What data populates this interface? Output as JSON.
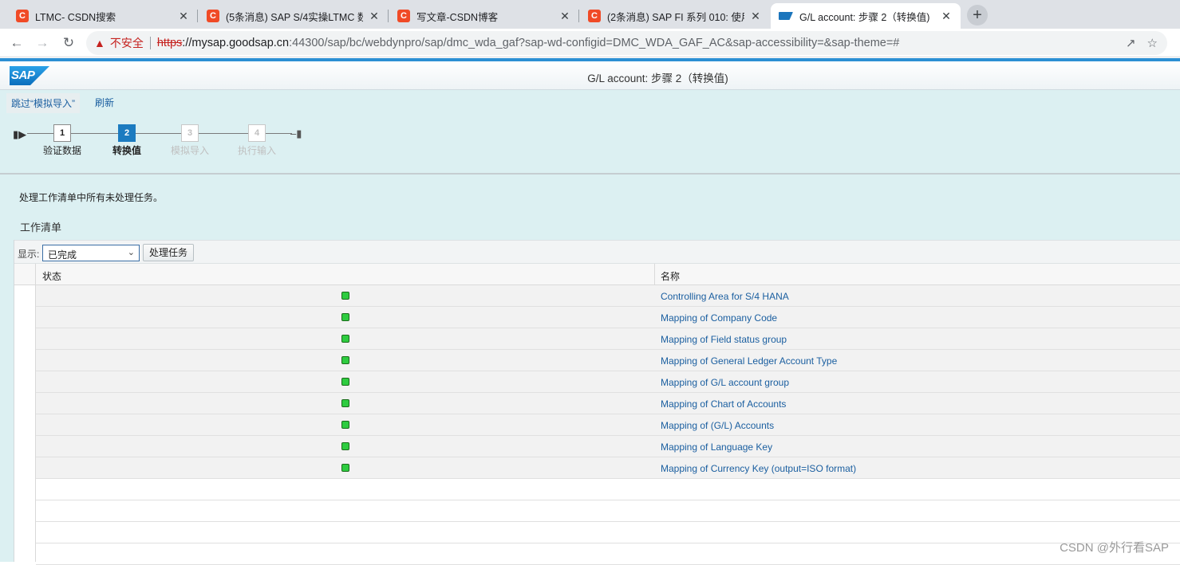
{
  "browser": {
    "tabs": [
      {
        "title": "LTMC- CSDN搜索",
        "icon": "csdn-icon"
      },
      {
        "title": "(5条消息) SAP S/4实操LTMC 数",
        "icon": "csdn-icon"
      },
      {
        "title": "写文章-CSDN博客",
        "icon": "csdn-icon"
      },
      {
        "title": "(2条消息) SAP FI 系列 010: 使用",
        "icon": "csdn-icon"
      },
      {
        "title": "G/L account: 步骤 2（转换值)",
        "icon": "sap-icon",
        "active": true
      }
    ],
    "close_glyph": "✕",
    "new_tab_glyph": "+",
    "address": {
      "security_label": "不安全",
      "url_scheme": "https",
      "url_host": "://mysap.goodsap.cn",
      "url_rest": ":44300/sap/bc/webdynpro/sap/dmc_wda_gaf?sap-wd-configid=DMC_WDA_GAF_AC&sap-accessibility=&sap-theme=#"
    }
  },
  "sap": {
    "logo_text": "SAP",
    "app_title": "G/L account: 步骤 2（转换值)",
    "actions": [
      "跳过“模拟导入”",
      "刷新"
    ],
    "roadmap": {
      "steps": [
        {
          "num": "1",
          "label": "验证数据",
          "state": "done"
        },
        {
          "num": "2",
          "label": "转换值",
          "state": "current"
        },
        {
          "num": "3",
          "label": "模拟导入",
          "state": "disabled"
        },
        {
          "num": "4",
          "label": "执行输入",
          "state": "disabled"
        }
      ]
    },
    "instruction": "处理工作清单中所有未处理任务。",
    "worklist_title": "工作清单",
    "toolbar": {
      "show_label": "显示:",
      "filter_value": "已完成",
      "process_button": "处理任务"
    },
    "table": {
      "headers": {
        "status": "状态",
        "name": "名称"
      },
      "rows": [
        {
          "status": "green",
          "name": "Controlling Area for S/4 HANA"
        },
        {
          "status": "green",
          "name": "Mapping of Company Code"
        },
        {
          "status": "green",
          "name": "Mapping of Field status group"
        },
        {
          "status": "green",
          "name": "Mapping of General Ledger Account Type"
        },
        {
          "status": "green",
          "name": "Mapping of G/L account group"
        },
        {
          "status": "green",
          "name": "Mapping of Chart of Accounts"
        },
        {
          "status": "green",
          "name": "Mapping of (G/L) Accounts"
        },
        {
          "status": "green",
          "name": "Mapping of Language Key"
        },
        {
          "status": "green",
          "name": "Mapping of Currency Key (output=ISO format)"
        }
      ]
    },
    "status_color_green": "#2ecc40"
  },
  "watermark": "CSDN @外行看SAP"
}
